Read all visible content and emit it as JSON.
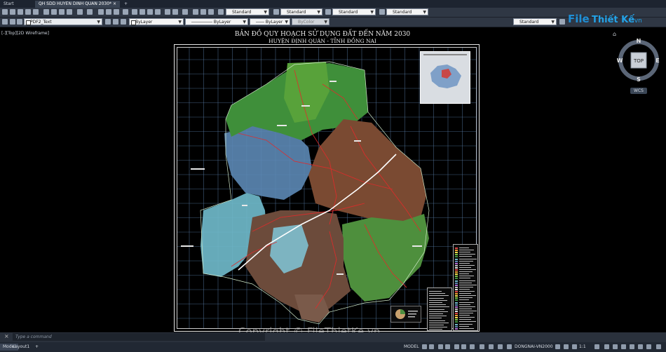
{
  "tabs": [
    {
      "label": "Start"
    },
    {
      "label": "QH SDD HUYEN DINH QUAN 2030*"
    }
  ],
  "toolbar": {
    "text_style": "Standard",
    "dim_style": "Standard",
    "table_style": "Standard",
    "mleader_style": "Standard",
    "layer": "PDF2_Text",
    "color": "ByLayer",
    "linetype": "ByLayer",
    "lineweight": "ByLayer",
    "plotstyle": "ByColor",
    "visual_style": "Standard"
  },
  "viewport": {
    "label": "[-][Top][2D Wireframe]"
  },
  "drawing": {
    "title": "BẢN ĐỒ QUY HOẠCH SỬ DỤNG ĐẤT ĐẾN NĂM 2030",
    "subtitle": "HUYỆN ĐỊNH QUÁN - TỈNH ĐỒNG NAI"
  },
  "navcube": {
    "n": "N",
    "s": "S",
    "e": "E",
    "w": "W",
    "top": "TOP",
    "wcs": "WCS"
  },
  "watermark": {
    "logo_a": "File",
    "logo_b": "Thiết Kế",
    "logo_c": ".vn",
    "copyright": "Copyright © FileThietKe.vn"
  },
  "command": {
    "placeholder": "Type a command"
  },
  "layouts": [
    {
      "label": "Model"
    },
    {
      "label": "Layout1"
    },
    {
      "label": "+"
    }
  ],
  "status": {
    "model": "MODEL",
    "coord_system": "DONGNAI-VN2000",
    "annotation_scale": "1:1"
  },
  "colors": {
    "chrome": "#2f3744",
    "accent": "#1f8fd6",
    "landuse_green": "#3f8f3a",
    "water": "#6fb9c9",
    "roads": "#e32a2a"
  }
}
